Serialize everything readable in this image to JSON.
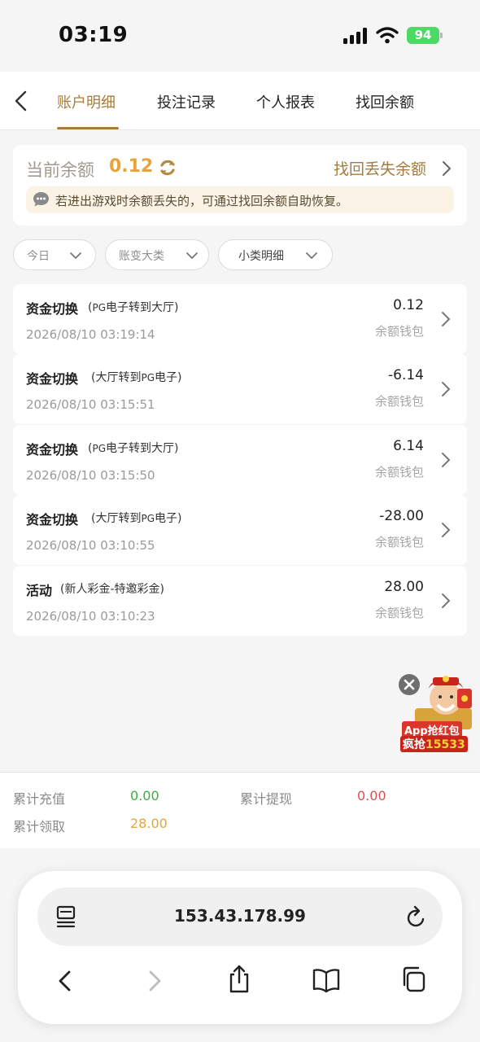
{
  "status_bar": {
    "time": "03:19",
    "battery": "94"
  },
  "tabs": [
    {
      "label": "账户明细",
      "active": true
    },
    {
      "label": "投注记录"
    },
    {
      "label": "个人报表"
    },
    {
      "label": "找回余额"
    }
  ],
  "balance": {
    "label": "当前余额",
    "value": "0.12",
    "recover_label": "找回丢失余额",
    "notice": "若进出游戏时余额丢失的，可通过找回余额自助恢复。"
  },
  "filters": [
    {
      "label": "今日"
    },
    {
      "label": "账变大类"
    },
    {
      "label": "小类明细"
    }
  ],
  "records": [
    {
      "title": "资金切换",
      "sub_prefix": "(",
      "sub_brand": "PG",
      "sub_rest": "电子转到大厅)",
      "date": "2026/08/10 03:19:14",
      "amount": "0.12",
      "wallet": "余额钱包"
    },
    {
      "title": "资金切换",
      "sub_prefix": "(大厅转到",
      "sub_brand": "PG",
      "sub_rest": "电子)",
      "date": "2026/08/10 03:15:51",
      "amount": "-6.14",
      "wallet": "余额钱包"
    },
    {
      "title": "资金切换",
      "sub_prefix": "(",
      "sub_brand": "PG",
      "sub_rest": "电子转到大厅)",
      "date": "2026/08/10 03:15:50",
      "amount": "6.14",
      "wallet": "余额钱包"
    },
    {
      "title": "资金切换",
      "sub_prefix": "(大厅转到",
      "sub_brand": "PG",
      "sub_rest": "电子)",
      "date": "2026/08/10 03:10:55",
      "amount": "-28.00",
      "wallet": "余额钱包"
    },
    {
      "title": "活动",
      "sub_prefix": "(新人彩金-特邀彩金)",
      "sub_brand": "",
      "sub_rest": "",
      "date": "2026/08/10 03:10:23",
      "amount": "28.00",
      "wallet": "余额钱包"
    }
  ],
  "promo": {
    "line1": "App抢红包",
    "line2_label": "疯抢",
    "line2_value": "15533"
  },
  "summary": {
    "deposit_label": "累计充值",
    "deposit_value": "0.00",
    "withdraw_label": "累计提现",
    "withdraw_value": "0.00",
    "claim_label": "累计领取",
    "claim_value": "28.00"
  },
  "browser": {
    "url": "153.43.178.99"
  },
  "colors": {
    "accent": "#a67c3d",
    "balance": "#e6a43a",
    "deposit": "#3fae3f",
    "withdraw": "#d9534f",
    "claim": "#e6a43a"
  }
}
